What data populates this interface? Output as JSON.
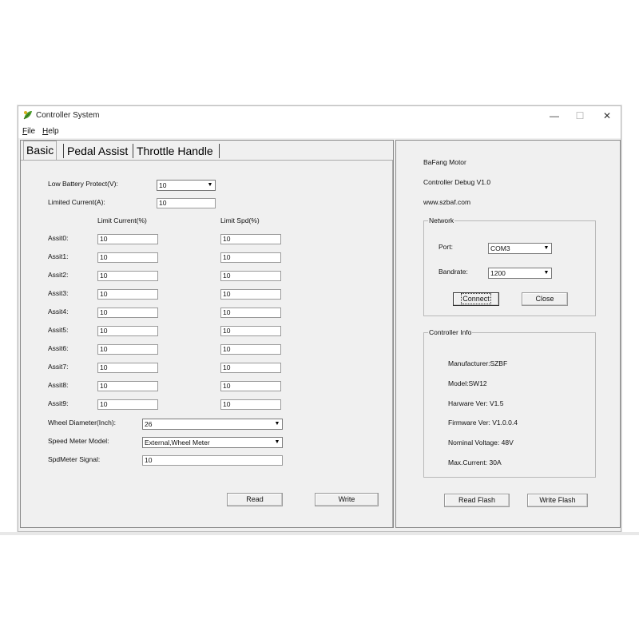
{
  "window": {
    "title": "Controller System",
    "controls": {
      "minimize": "—",
      "maximize": "☐",
      "close": "✕"
    }
  },
  "menu": [
    {
      "label": "File",
      "accel": "F",
      "rest": "ile"
    },
    {
      "label": "Help",
      "accel": "H",
      "rest": "elp"
    }
  ],
  "tabs": [
    "Basic",
    "Pedal Assist",
    "Throttle Handle"
  ],
  "basic": {
    "low_battery_label": "Low Battery Protect(V):",
    "low_battery_value": "10",
    "limited_current_label": "Limited Current(A):",
    "limited_current_value": "10",
    "col_limit_current": "Limit Current(%)",
    "col_limit_spd": "Limit Spd(%)",
    "assists": [
      {
        "label": "Assit0:",
        "current": "10",
        "spd": "10"
      },
      {
        "label": "Assit1:",
        "current": "10",
        "spd": "10"
      },
      {
        "label": "Assit2:",
        "current": "10",
        "spd": "10"
      },
      {
        "label": "Assit3:",
        "current": "10",
        "spd": "10"
      },
      {
        "label": "Assit4:",
        "current": "10",
        "spd": "10"
      },
      {
        "label": "Assit5:",
        "current": "10",
        "spd": "10"
      },
      {
        "label": "Assit6:",
        "current": "10",
        "spd": "10"
      },
      {
        "label": "Assit7:",
        "current": "10",
        "spd": "10"
      },
      {
        "label": "Assit8:",
        "current": "10",
        "spd": "10"
      },
      {
        "label": "Assit9:",
        "current": "10",
        "spd": "10"
      }
    ],
    "wheel_diameter_label": "Wheel Diameter(Inch):",
    "wheel_diameter_value": "26",
    "speed_meter_model_label": "Speed Meter Model:",
    "speed_meter_model_value": "External,Wheel Meter",
    "spdmeter_signal_label": "SpdMeter Signal:",
    "spdmeter_signal_value": "10",
    "read_button": "Read",
    "write_button": "Write"
  },
  "info": {
    "brand": "BaFang Motor",
    "debug": "Controller Debug V1.0",
    "website": "www.szbaf.com"
  },
  "network": {
    "title": "Network",
    "port_label": "Port:",
    "port_value": "COM3",
    "baudrate_label": "Bandrate:",
    "baudrate_value": "1200",
    "connect_button": "Connect",
    "close_button": "Close"
  },
  "controller_info": {
    "title": "Controller Info",
    "manufacturer": "Manufacturer:SZBF",
    "model": "Model:SW12",
    "hardware": "Harware Ver: V1.5",
    "firmware": "Firmware Ver: V1.0.0.4",
    "voltage": "Nominal Voltage: 48V",
    "max_current": "Max.Current: 30A"
  },
  "flash": {
    "read_flash": "Read Flash",
    "write_flash": "Write Flash"
  }
}
